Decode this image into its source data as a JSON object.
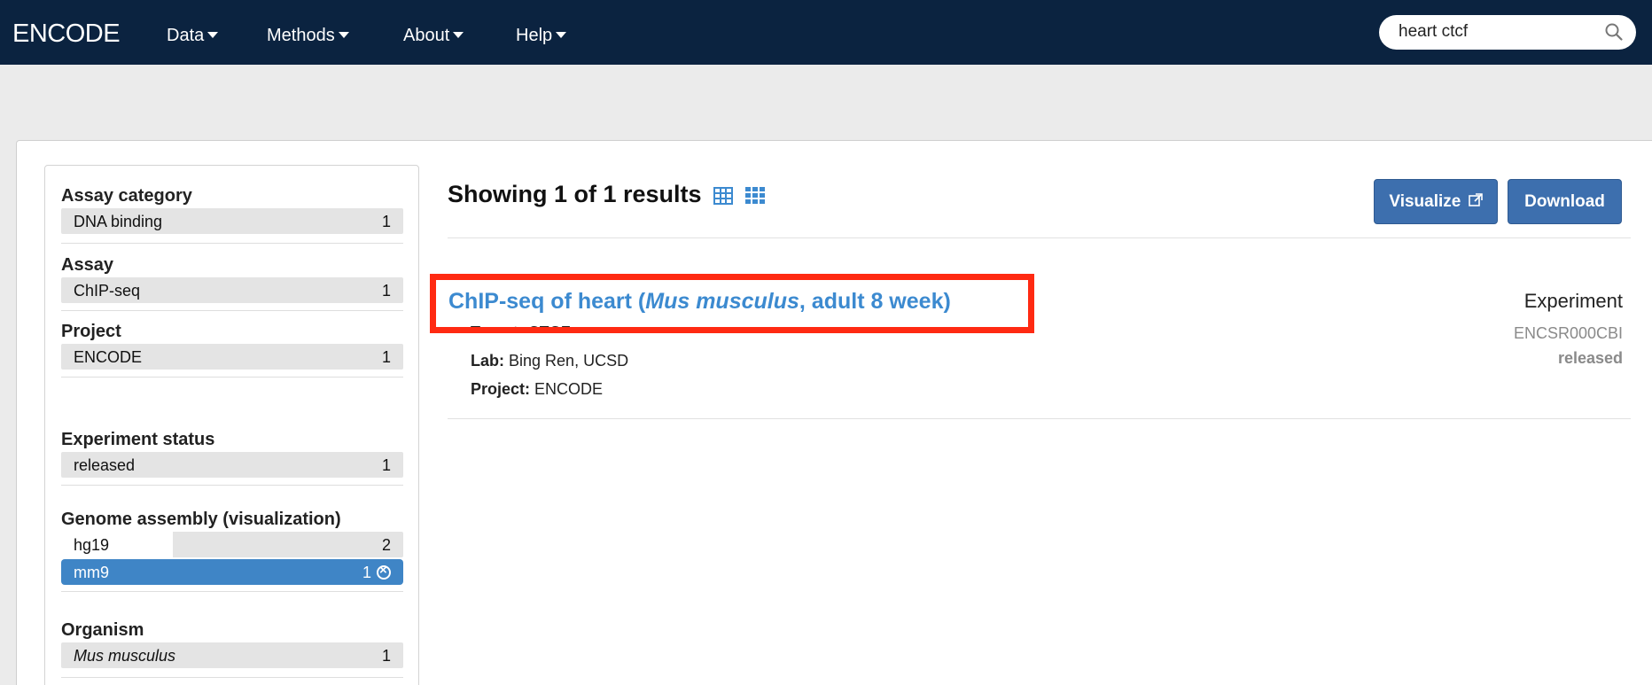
{
  "navbar": {
    "brand": "ENCODE",
    "menu": [
      {
        "label": "Data"
      },
      {
        "label": "Methods"
      },
      {
        "label": "About"
      },
      {
        "label": "Help"
      }
    ],
    "search_value": "heart ctcf"
  },
  "facets": [
    {
      "title": "Assay category",
      "items": [
        {
          "label": "DNA binding",
          "count": "1"
        }
      ]
    },
    {
      "title": "Assay",
      "items": [
        {
          "label": "ChIP-seq",
          "count": "1"
        }
      ]
    },
    {
      "title": "Project",
      "items": [
        {
          "label": "ENCODE",
          "count": "1"
        }
      ]
    },
    {
      "title": "Experiment status",
      "items": [
        {
          "label": "released",
          "count": "1"
        }
      ]
    },
    {
      "title": "Genome assembly (visualization)",
      "items": [
        {
          "label": "hg19",
          "count": "2"
        },
        {
          "label": "mm9",
          "count": "1",
          "selected": true
        }
      ]
    },
    {
      "title": "Organism",
      "items": [
        {
          "label": "Mus musculus",
          "count": "1"
        }
      ]
    }
  ],
  "results": {
    "heading": "Showing 1 of 1 results",
    "visualize_label": "Visualize",
    "download_label": "Download",
    "item": {
      "title_prefix": "ChIP-seq of heart (",
      "title_species": "Mus musculus",
      "title_suffix": ", adult 8 week)",
      "target_label": "Target:",
      "target_value": "CTCF",
      "lab_label": "Lab:",
      "lab_value": "Bing Ren, UCSD",
      "project_label": "Project:",
      "project_value": "ENCODE",
      "type": "Experiment",
      "accession": "ENCSR000CBI",
      "status": "released"
    }
  },
  "colors": {
    "navbar": "#0b2340",
    "link": "#3c8ad0",
    "button": "#3d6fae",
    "selected_facet": "#3f85c6",
    "highlight_box": "#ff2a12"
  }
}
